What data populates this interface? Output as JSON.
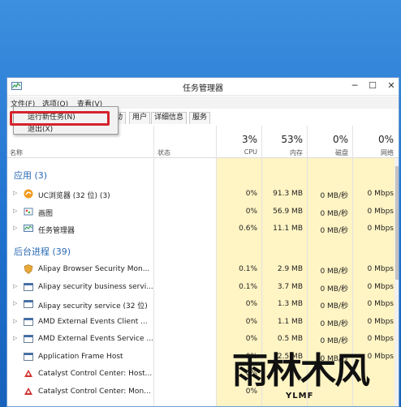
{
  "window": {
    "title": "任务管理器",
    "min_glyph": "─",
    "max_glyph": "☐",
    "close_glyph": "✕"
  },
  "menu": [
    "文件(F)",
    "选项(O)",
    "查看(V)"
  ],
  "dropdown": [
    "运行新任务(N)",
    "退出(X)"
  ],
  "tabs": [
    "启动",
    "用户",
    "详细信息",
    "服务"
  ],
  "header": {
    "name": "名称",
    "status": "状态",
    "cpu": {
      "pct": "3%",
      "label": "CPU"
    },
    "mem": {
      "pct": "53%",
      "label": "内存"
    },
    "disk": {
      "pct": "0%",
      "label": "磁盘"
    },
    "net": {
      "pct": "0%",
      "label": "网络"
    }
  },
  "groups": {
    "apps": "应用 (3)",
    "background": "后台进程 (39)"
  },
  "apps": [
    {
      "name": "UC浏览器 (32 位) (3)",
      "cpu": "0%",
      "mem": "91.3 MB",
      "disk": "0 MB/秒",
      "net": "0 Mbps",
      "icon": "uc-browser-icon"
    },
    {
      "name": "画图",
      "cpu": "0%",
      "mem": "56.9 MB",
      "disk": "0 MB/秒",
      "net": "0 Mbps",
      "icon": "paint-icon"
    },
    {
      "name": "任务管理器",
      "cpu": "0.6%",
      "mem": "11.1 MB",
      "disk": "0 MB/秒",
      "net": "0 Mbps",
      "icon": "task-manager-icon"
    }
  ],
  "background": [
    {
      "name": "Alipay Browser Security Mon...",
      "cpu": "0.1%",
      "mem": "2.9 MB",
      "disk": "0 MB/秒",
      "net": "0 Mbps",
      "icon": "alipay-shield-icon"
    },
    {
      "name": "Alipay security business servi...",
      "cpu": "0.1%",
      "mem": "3.7 MB",
      "disk": "0 MB/秒",
      "net": "0 Mbps",
      "icon": "service-window-icon"
    },
    {
      "name": "Alipay security service (32 位)",
      "cpu": "0%",
      "mem": "1.3 MB",
      "disk": "0 MB/秒",
      "net": "0 Mbps",
      "icon": "service-window-icon"
    },
    {
      "name": "AMD External Events Client ...",
      "cpu": "0%",
      "mem": "1.1 MB",
      "disk": "0 MB/秒",
      "net": "0 Mbps",
      "icon": "service-window-icon"
    },
    {
      "name": "AMD External Events Service ...",
      "cpu": "0%",
      "mem": "0.5 MB",
      "disk": "0 MB/秒",
      "net": "0 Mbps",
      "icon": "service-window-icon"
    },
    {
      "name": "Application Frame Host",
      "cpu": "0%",
      "mem": "2.5 MB",
      "disk": "0 MB/秒",
      "net": "0 Mbps",
      "icon": "service-window-icon"
    },
    {
      "name": "Catalyst Control Center: Host...",
      "cpu": "0%",
      "mem": "",
      "disk": "",
      "net": "",
      "icon": "catalyst-icon"
    },
    {
      "name": "Catalyst Control Center: Mon...",
      "cpu": "0%",
      "mem": "",
      "disk": "",
      "net": "",
      "icon": "catalyst-icon"
    }
  ],
  "watermark": {
    "big": "雨林木风",
    "small": "YLMF"
  },
  "colors": {
    "heat": "#fff4c4",
    "group": "#2a6ab5",
    "highlight": "#d4232b"
  }
}
